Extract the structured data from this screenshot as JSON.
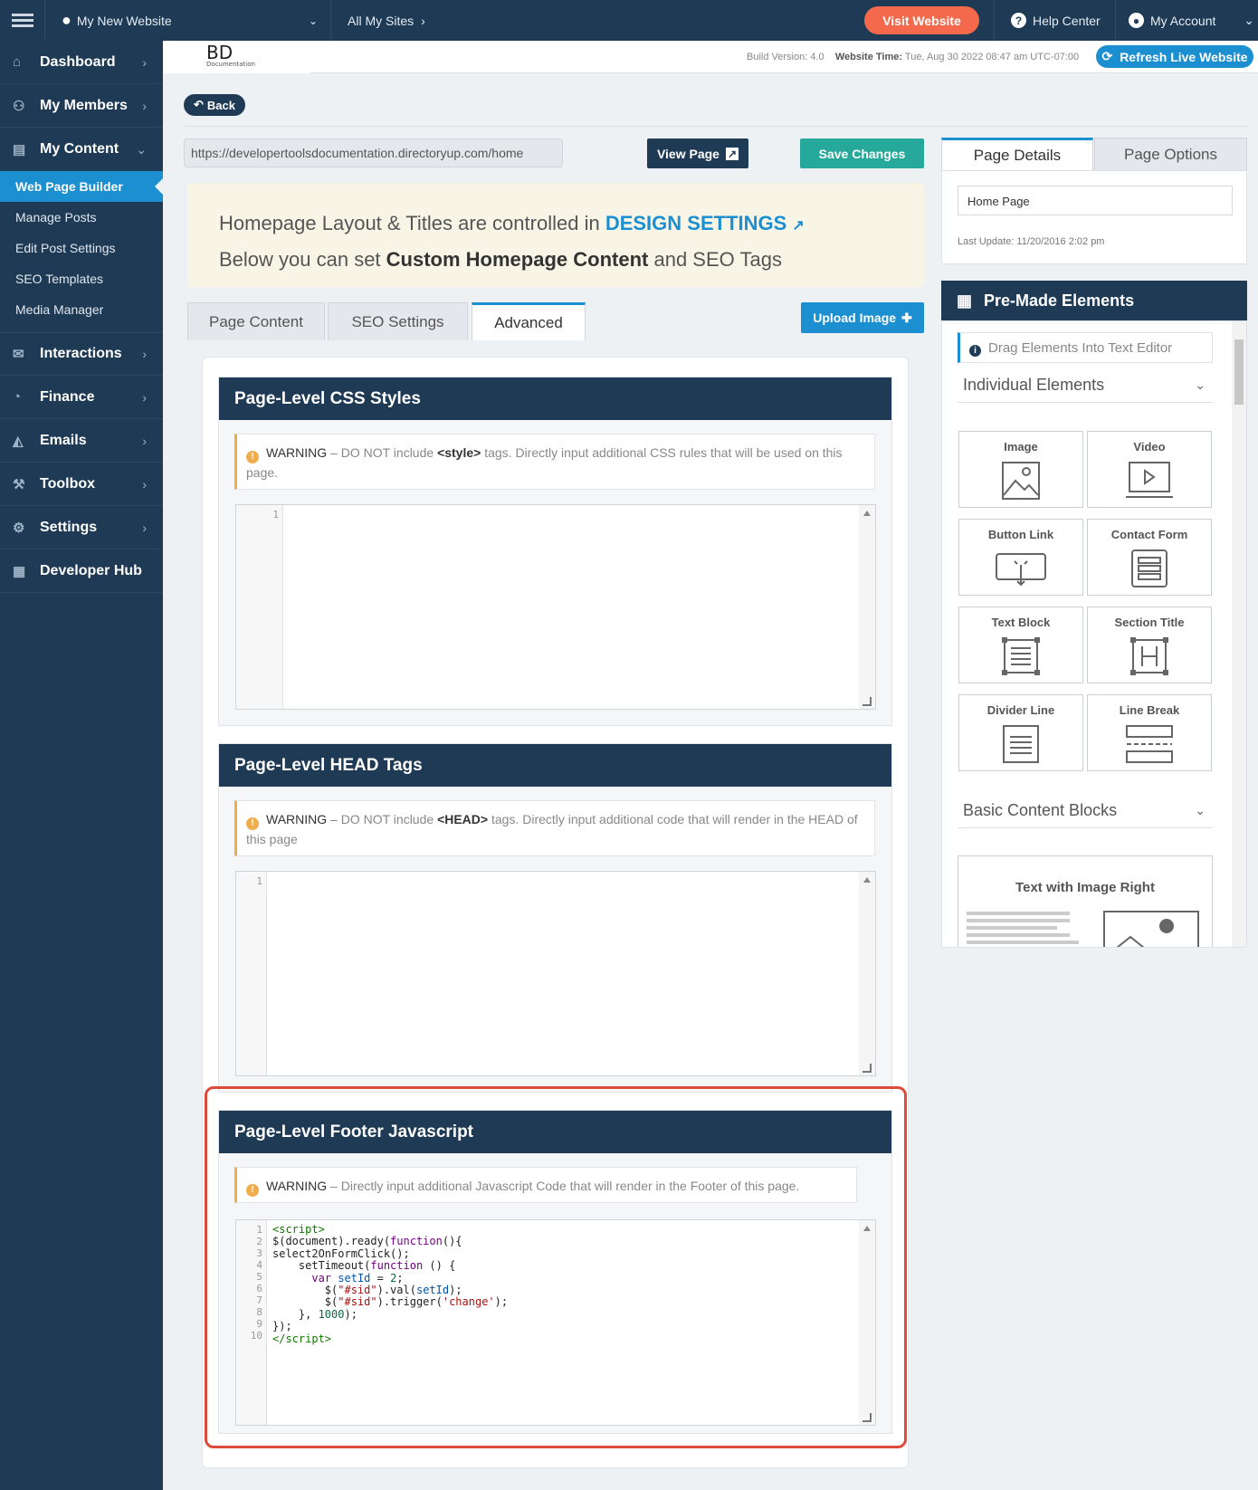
{
  "topbar": {
    "site_name": "My New Website",
    "all_sites": "All My Sites",
    "visit_label": "Visit Website",
    "help_label": "Help Center",
    "account_label": "My Account"
  },
  "sidebar": {
    "items": [
      {
        "label": "Dashboard",
        "icon": "home-icon"
      },
      {
        "label": "My Members",
        "icon": "users-icon"
      },
      {
        "label": "My Content",
        "icon": "folder-icon"
      },
      {
        "label": "Interactions",
        "icon": "chat-icon"
      },
      {
        "label": "Finance",
        "icon": "pie-chart-icon"
      },
      {
        "label": "Emails",
        "icon": "inbox-icon"
      },
      {
        "label": "Toolbox",
        "icon": "wrench-icon"
      },
      {
        "label": "Settings",
        "icon": "gear-icon"
      },
      {
        "label": "Developer Hub",
        "icon": "grid-icon"
      }
    ],
    "content_sub": [
      "Web Page Builder",
      "Manage Posts",
      "Edit Post Settings",
      "SEO Templates",
      "Media Manager"
    ]
  },
  "header": {
    "logo_text": "BD",
    "logo_sub": "Documentation",
    "build_version": "Build Version: 4.0",
    "website_time_label": "Website Time:",
    "website_time": "Tue, Aug 30 2022 08:47 am UTC-07:00",
    "refresh_label": "Refresh Live Website"
  },
  "main": {
    "back_label": "Back",
    "url": "https://developertoolsdocumentation.directoryup.com/home",
    "view_label": "View Page",
    "save_label": "Save Changes",
    "notice_line1": "Homepage Layout & Titles are controlled in",
    "notice_link": "DESIGN SETTINGS",
    "notice_line2a": "Below you can set",
    "notice_line2b": "Custom Homepage Content",
    "notice_line2c": "and SEO Tags",
    "tabs": [
      "Page Content",
      "SEO Settings",
      "Advanced"
    ],
    "upload_label": "Upload Image",
    "css_title": "Page-Level CSS Styles",
    "css_warn_label": "WARNING",
    "css_warn_a": "– DO NOT include",
    "css_warn_tag": "<style>",
    "css_warn_b": "tags. Directly input additional CSS rules that will be used on this page.",
    "head_title": "Page-Level HEAD Tags",
    "head_warn_label": "WARNING",
    "head_warn_a": "– DO NOT include",
    "head_warn_tag": "<HEAD>",
    "head_warn_b": "tags. Directly input additional code that will render in the HEAD of this page",
    "js_title": "Page-Level Footer Javascript",
    "js_warn_label": "WARNING",
    "js_warn_text": "– Directly input additional Javascript Code that will render in the Footer of this page.",
    "line_one": "1",
    "js_line_numbers": "1\n2\n3\n4\n5\n6\n7\n8\n9\n10"
  },
  "right": {
    "tabs": [
      "Page Details",
      "Page Options"
    ],
    "page_name": "Home Page",
    "last_update": "Last Update: 11/20/2016 2:02 pm",
    "premade_title": "Pre-Made Elements",
    "drag_note": "Drag Elements Into Text Editor",
    "individual_label": "Individual Elements",
    "elements": [
      "Image",
      "Video",
      "Button Link",
      "Contact Form",
      "Text Block",
      "Section Title",
      "Divider Line",
      "Line Break"
    ],
    "basic_label": "Basic Content Blocks",
    "block_label": "Text with Image Right"
  }
}
